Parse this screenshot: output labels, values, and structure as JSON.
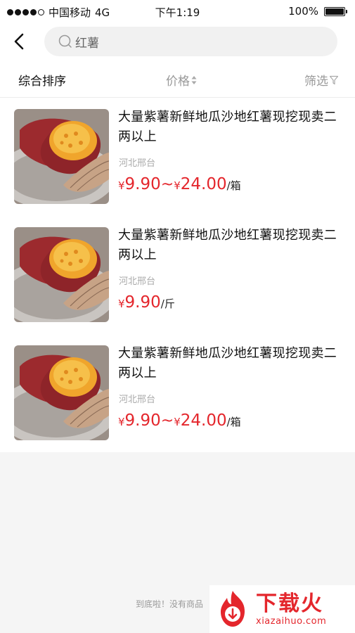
{
  "status_bar": {
    "carrier": "中国移动",
    "network": "4G",
    "time": "下午1:19",
    "battery": "100%"
  },
  "search": {
    "query": "红薯"
  },
  "sort_bar": {
    "composite": "综合排序",
    "price": "价格",
    "filter": "筛选"
  },
  "products": [
    {
      "title": "大量紫薯新鲜地瓜沙地红薯现挖现卖二两以上",
      "location": "河北邢台",
      "price_low": "9.90",
      "price_high": "24.00",
      "unit": "/箱",
      "currency": "¥"
    },
    {
      "title": "大量紫薯新鲜地瓜沙地红薯现挖现卖二两以上",
      "location": "河北邢台",
      "price_low": "9.90",
      "unit": "/斤",
      "currency": "¥"
    },
    {
      "title": "大量紫薯新鲜地瓜沙地红薯现挖现卖二两以上",
      "location": "河北邢台",
      "price_low": "9.90",
      "price_high": "24.00",
      "unit": "/箱",
      "currency": "¥"
    }
  ],
  "footer": {
    "note": "到底啦！没有商品"
  },
  "watermark": {
    "brand": "下载火",
    "url": "xiazaihuo.com"
  },
  "colors": {
    "accent": "#e4262c",
    "background": "#f5f5f5"
  },
  "icons": [
    "back-arrow-icon",
    "search-icon",
    "sort-arrows-icon",
    "filter-icon",
    "battery-icon"
  ]
}
